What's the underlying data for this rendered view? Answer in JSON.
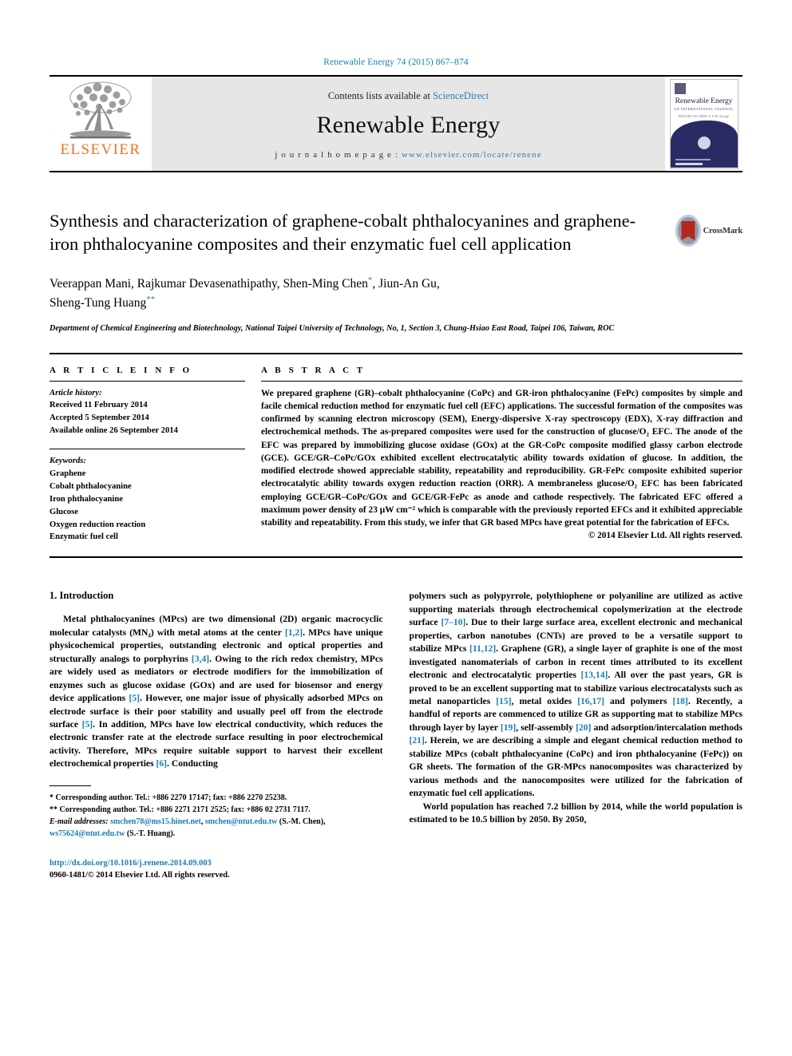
{
  "running_head": "Renewable Energy 74 (2015) 867–874",
  "masthead": {
    "publisher_name": "ELSEVIER",
    "publisher_logo_icon": "elsevier-tree-icon",
    "contents_prefix": "Contents lists available at ",
    "contents_link": "ScienceDirect",
    "journal_name": "Renewable Energy",
    "homepage_label": "j o u r n a l   h o m e p a g e :  ",
    "homepage_url": "www.elsevier.com/locate/renene",
    "cover": {
      "title": "Renewable Energy",
      "subtitle": "AN INTERNATIONAL JOURNAL",
      "subtitle2": "EDITORS-IN-CHIEF  A.A.M. Sayigh"
    }
  },
  "article": {
    "title": "Synthesis and characterization of graphene-cobalt phthalocyanines and graphene-iron phthalocyanine composites and their enzymatic fuel cell application",
    "crossmark_label": "CrossMark",
    "authors_line1": "Veerappan Mani, Rajkumar Devasenathipathy, Shen-Ming Chen",
    "authors_mark1": "*",
    "authors_line1b": ", Jiun-An Gu,",
    "authors_line2": "Sheng-Tung Huang",
    "authors_mark2": "**",
    "affiliation": "Department of Chemical Engineering and Biotechnology, National Taipei University of Technology, No, 1, Section 3, Chung-Hsiao East Road, Taipei 106, Taiwan, ROC"
  },
  "article_info": {
    "heading": "A R T I C L E   I N F O",
    "history_label": "Article history:",
    "history": [
      "Received 11 February 2014",
      "Accepted 5 September 2014",
      "Available online 26 September 2014"
    ],
    "keywords_label": "Keywords:",
    "keywords": [
      "Graphene",
      "Cobalt phthalocyanine",
      "Iron phthalocyanine",
      "Glucose",
      "Oxygen reduction reaction",
      "Enzymatic fuel cell"
    ]
  },
  "abstract": {
    "heading": "A B S T R A C T",
    "text": "We prepared graphene (GR)–cobalt phthalocyanine (CoPc) and GR-iron phthalocyanine (FePc) composites by simple and facile chemical reduction method for enzymatic fuel cell (EFC) applications. The successful formation of the composites was confirmed by scanning electron microscopy (SEM), Energy-dispersive X-ray spectroscopy (EDX), X-ray diffraction and electrochemical methods. The as-prepared composites were used for the construction of glucose/O₂ EFC. The anode of the EFC was prepared by immobilizing glucose oxidase (GOx) at the GR-CoPc composite modified glassy carbon electrode (GCE). GCE/GR–CoPc/GOx exhibited excellent electrocatalytic ability towards oxidation of glucose. In addition, the modified electrode showed appreciable stability, repeatability and reproducibility. GR-FePc composite exhibited superior electrocatalytic ability towards oxygen reduction reaction (ORR). A membraneless glucose/O₂ EFC has been fabricated employing GCE/GR–CoPc/GOx and GCE/GR-FePc as anode and cathode respectively. The fabricated EFC offered a maximum power density of 23 μW cm⁻² which is comparable with the previously reported EFCs and it exhibited appreciable stability and repeatability. From this study, we infer that GR based MPcs have great potential for the fabrication of EFCs.",
    "copyright": "© 2014 Elsevier Ltd. All rights reserved."
  },
  "introduction": {
    "heading": "1.  Introduction",
    "left_paragraph_1": "Metal phthalocyanines (MPcs) are two dimensional (2D) organic macrocyclic molecular catalysts (MN₄) with metal atoms at the center [1,2]. MPcs have unique physicochemical properties, outstanding electronic and optical properties and structurally analogs to porphyrins [3,4]. Owing to the rich redox chemistry, MPcs are widely used as mediators or electrode modifiers for the immobilization of enzymes such as glucose oxidase (GOx) and are used for biosensor and energy device applications [5]. However, one major issue of physically adsorbed MPcs on electrode surface is their poor stability and usually peel off from the electrode surface [5]. In addition, MPcs have low electrical conductivity, which reduces the electronic transfer rate at the electrode surface resulting in poor electrochemical activity. Therefore, MPcs require suitable support to harvest their excellent electrochemical properties [6]. Conducting",
    "right_paragraph_1": "polymers such as polypyrrole, polythiophene or polyaniline are utilized as active supporting materials through electrochemical copolymerization at the electrode surface [7–10]. Due to their large surface area, excellent electronic and mechanical properties, carbon nanotubes (CNTs) are proved to be a versatile support to stabilize MPcs [11,12]. Graphene (GR), a single layer of graphite is one of the most investigated nanomaterials of carbon in recent times attributed to its excellent electronic and electrocatalytic properties [13,14]. All over the past years, GR is proved to be an excellent supporting mat to stabilize various electrocatalysts such as metal nanoparticles [15], metal oxides [16,17] and polymers [18]. Recently, a handful of reports are commenced to utilize GR as supporting mat to stabilize MPcs through layer by layer [19], self-assembly [20] and adsorption/intercalation methods [21]. Herein, we are describing a simple and elegant chemical reduction method to stabilize MPcs (cobalt phthalocyanine (CoPc) and iron phthalocyanine (FePc)) on GR sheets. The formation of the GR-MPcs nanocomposites was characterized by various methods and the nanocomposites were utilized for the fabrication of enzymatic fuel cell applications.",
    "right_paragraph_2": "World population has reached 7.2 billion by 2014, while the world population is estimated to be 10.5 billion by 2050. By 2050,"
  },
  "footnotes": {
    "line1": "*  Corresponding author. Tel.: +886 2270 17147; fax: +886 2270 25238.",
    "line2": "**  Corresponding author. Tel.: +886 2271 2171 2525; fax: +886 02 2731 7117.",
    "email_label": "E-mail      addresses:",
    "email1": "smchen78@ms15.hinet.net",
    "email_sep": ",",
    "email2": "smchen@ntut.edu.tw",
    "email_attrib1": "(S.-M. Chen),",
    "email3": "ws75624@ntut.edu.tw",
    "email_attrib2": "(S.-T. Huang)."
  },
  "footer": {
    "doi": "http://dx.doi.org/10.1016/j.renene.2014.09.003",
    "issn_line": "0960-1481/© 2014 Elsevier Ltd. All rights reserved."
  },
  "colors": {
    "link_blue": "#1a7cb5",
    "elsevier_orange": "#E87722",
    "masthead_grey": "#e6e6e6"
  }
}
